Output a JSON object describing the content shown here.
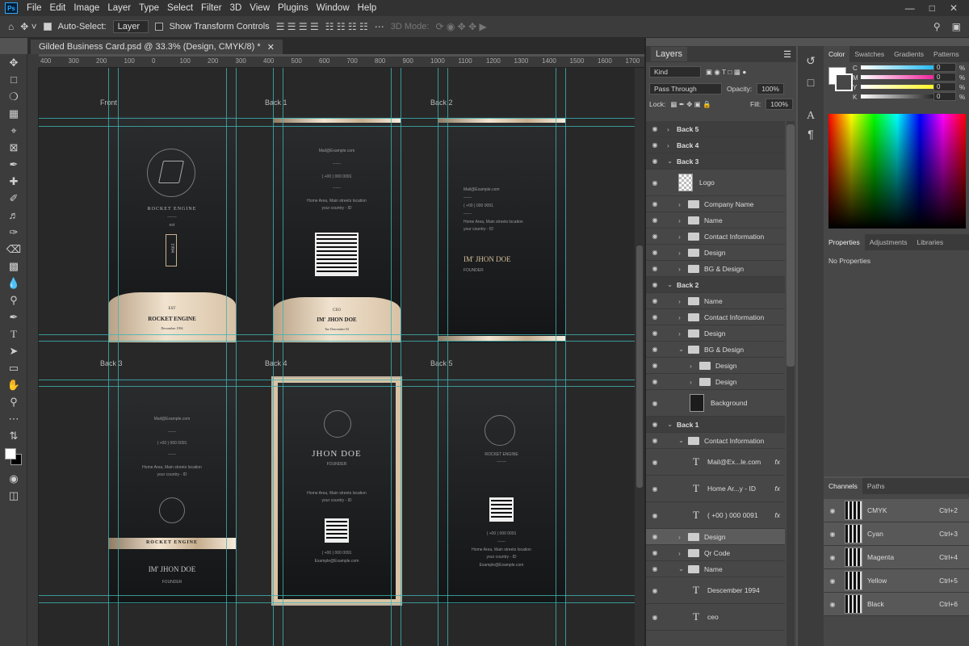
{
  "menu": {
    "items": [
      "File",
      "Edit",
      "Image",
      "Layer",
      "Type",
      "Select",
      "Filter",
      "3D",
      "View",
      "Plugins",
      "Window",
      "Help"
    ]
  },
  "options": {
    "auto_select_label": "Auto-Select:",
    "auto_select_value": "Layer",
    "show_transform_label": "Show Transform Controls",
    "mode_3d": "3D Mode:"
  },
  "document": {
    "tab_title": "Gilded Business Card.psd @ 33.3% (Design, CMYK/8) *"
  },
  "ruler": {
    "h": [
      "400",
      "300",
      "200",
      "100",
      "0",
      "100",
      "200",
      "300",
      "400",
      "500",
      "600",
      "700",
      "800",
      "900",
      "1000",
      "1100",
      "1200",
      "1300",
      "1400",
      "1500",
      "1600",
      "1700"
    ]
  },
  "canvas_labels": {
    "front": "Front",
    "back1": "Back 1",
    "back2": "Back 2",
    "back3": "Back 3",
    "back4": "Back 4",
    "back5": "Back 5"
  },
  "cards": {
    "front": {
      "company": "ROCKET ENGINE",
      "dashes": "-------",
      "est": "est",
      "year": "1994",
      "role": "EST",
      "name": "ROCKET ENGINE",
      "date": "Descember 1994"
    },
    "back1": {
      "mail": "Mail@Example.com",
      "dashes": "------",
      "phone": "( +00 ) 000 0091",
      "dashes2": "------",
      "addr1": "Home Area, Main streets location",
      "addr2": "your country - ID",
      "role": "CEO",
      "name": "IM' JHON DOE",
      "date": "Tue Descember 94"
    },
    "back2": {
      "mail": "Mail@Example.com",
      "dashes": "------",
      "phone": "( +00 ) 000 0091",
      "dashes2": "------",
      "addr1": "Home Area, Main streets location",
      "addr2": "your country - ID",
      "name": "IM' JHON DOE",
      "role": "FOUNDER"
    },
    "back3": {
      "mail": "Mail@Example.com",
      "dashes": "------",
      "phone": "( +00 ) 000 0091",
      "dashes2": "------",
      "addr1": "Home Area, Main streets location",
      "addr2": "your country - ID",
      "company": "ROCKET ENGINE",
      "name": "IM' JHON DOE",
      "role": "FOUNDER"
    },
    "back4": {
      "name": "JHON DOE",
      "role": "FOUNDER",
      "addr1": "Home Area, Main streets location",
      "addr2": "your country - ID",
      "phone": "( +00 ) 000 0091",
      "mail": "Example@Example.com"
    },
    "back5": {
      "company": "ROCKET ENGINE",
      "dashes": "-------",
      "phone": "( +00 ) 000 0091",
      "dashes2": "------",
      "addr1": "Home Area, Main streets location",
      "addr2": "your country - ID",
      "mail": "Example@Example.com"
    }
  },
  "layers_panel": {
    "tab": "Layers",
    "kind": "Kind",
    "blend": "Pass Through",
    "opacity_label": "Opacity:",
    "opacity": "100%",
    "lock_label": "Lock:",
    "fill_label": "Fill:",
    "fill": "100%",
    "rows": [
      {
        "name": "Back 5",
        "type": "group",
        "indent": 0
      },
      {
        "name": "Back 4",
        "type": "group",
        "indent": 0
      },
      {
        "name": "Back 3",
        "type": "group",
        "indent": 0,
        "open": true
      },
      {
        "name": "Logo",
        "type": "smart",
        "indent": 1
      },
      {
        "name": "Company Name",
        "type": "folder",
        "indent": 1
      },
      {
        "name": "Name",
        "type": "folder",
        "indent": 1
      },
      {
        "name": "Contact Information",
        "type": "folder",
        "indent": 1
      },
      {
        "name": "Design",
        "type": "folder",
        "indent": 1
      },
      {
        "name": "BG & Design",
        "type": "folder",
        "indent": 1
      },
      {
        "name": "Back 2",
        "type": "group",
        "indent": 0,
        "open": true
      },
      {
        "name": "Name",
        "type": "folder",
        "indent": 1
      },
      {
        "name": "Contact Information",
        "type": "folder",
        "indent": 1
      },
      {
        "name": "Design",
        "type": "folder",
        "indent": 1
      },
      {
        "name": "BG & Design",
        "type": "folder",
        "indent": 1,
        "open": true
      },
      {
        "name": "Design",
        "type": "folder",
        "indent": 2
      },
      {
        "name": "Design",
        "type": "folder",
        "indent": 2
      },
      {
        "name": "Background",
        "type": "pixel",
        "indent": 2
      },
      {
        "name": "Back 1",
        "type": "group",
        "indent": 0,
        "open": true
      },
      {
        "name": "Contact Information",
        "type": "folder",
        "indent": 1,
        "open": true
      },
      {
        "name": "Mail@Ex...le.com",
        "type": "text",
        "indent": 2,
        "fx": "fx"
      },
      {
        "name": "Home Ar...y - ID",
        "type": "text",
        "indent": 2,
        "fx": "fx"
      },
      {
        "name": "( +00 ) 000 0091",
        "type": "text",
        "indent": 2,
        "fx": "fx"
      },
      {
        "name": "Design",
        "type": "folder",
        "indent": 1,
        "selected": true
      },
      {
        "name": "Qr Code",
        "type": "folder",
        "indent": 1
      },
      {
        "name": "Name",
        "type": "folder",
        "indent": 1,
        "open": true
      },
      {
        "name": "Descember 1994",
        "type": "text",
        "indent": 2
      },
      {
        "name": "ceo",
        "type": "text",
        "indent": 2
      }
    ]
  },
  "color_panel": {
    "tabs": [
      "Color",
      "Swatches",
      "Gradients",
      "Patterns"
    ],
    "channels": [
      {
        "label": "C",
        "value": "0",
        "unit": "%"
      },
      {
        "label": "M",
        "value": "0",
        "unit": "%"
      },
      {
        "label": "Y",
        "value": "0",
        "unit": "%"
      },
      {
        "label": "K",
        "value": "0",
        "unit": "%"
      }
    ]
  },
  "properties_panel": {
    "tabs": [
      "Properties",
      "Adjustments",
      "Libraries"
    ],
    "empty": "No Properties"
  },
  "channels_panel": {
    "tabs": [
      "Channels",
      "Paths"
    ],
    "rows": [
      {
        "name": "CMYK",
        "shortcut": "Ctrl+2"
      },
      {
        "name": "Cyan",
        "shortcut": "Ctrl+3"
      },
      {
        "name": "Magenta",
        "shortcut": "Ctrl+4"
      },
      {
        "name": "Yellow",
        "shortcut": "Ctrl+5"
      },
      {
        "name": "Black",
        "shortcut": "Ctrl+6"
      }
    ]
  }
}
